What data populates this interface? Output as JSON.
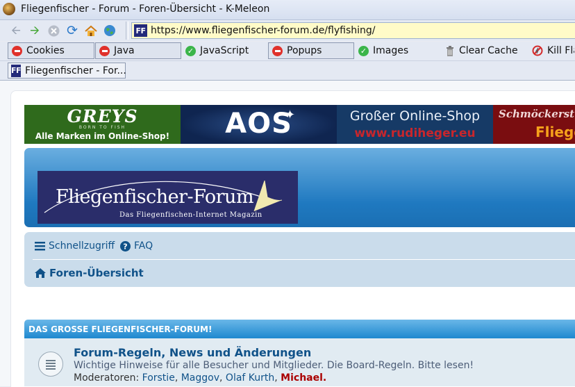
{
  "window": {
    "title": "Fliegenfischer - Forum - Foren-Übersicht - K-Meleon"
  },
  "navbar": {
    "url": "https://www.fliegenfischer-forum.de/flyfishing/",
    "site_icon": "FF",
    "buttons": [
      "back-icon",
      "forward-icon",
      "stop-icon",
      "reload-icon",
      "home-icon",
      "globe-icon"
    ]
  },
  "toggles": [
    {
      "label": "Cookies",
      "state": "off"
    },
    {
      "label": "Java",
      "state": "off"
    },
    {
      "label": "JavaScript",
      "state": "on"
    },
    {
      "label": "Popups",
      "state": "off"
    },
    {
      "label": "Images",
      "state": "on"
    },
    {
      "label": "Clear Cache",
      "icon": "trash-icon"
    },
    {
      "label": "Kill Fla",
      "icon": "no-flash-icon"
    }
  ],
  "tab": {
    "label": "Fliegenfischer - For...",
    "icon": "FF"
  },
  "banners": {
    "greys": {
      "brand": "GREYS",
      "tagline": "BORN TO FISH",
      "text": "Alle Marken im Online-Shop!"
    },
    "aos": {
      "brand": "AOS"
    },
    "rudiheger": {
      "line1": "Großer Online-Shop",
      "line2": "www.rudiheger.eu"
    },
    "schmoeckerstube": {
      "line1": "Schmöckerst",
      "line2": "Fliege"
    }
  },
  "logo": {
    "title": "Fliegenfischer-Forum",
    "subtitle": "Das Fliegenfischen-Internet Magazin"
  },
  "forum_nav": {
    "quick_link": "Schnellzugriff",
    "faq": "FAQ",
    "breadcrumb": "Foren-Übersicht"
  },
  "category": {
    "title": "DAS GROSSE FLIEGENFISCHER-FORUM!",
    "forums": [
      {
        "title": "Forum-Regeln, News und Änderungen",
        "description": "Wichtige Hinweise für alle Besucher und Mitglieder. Die Board-Regeln. Bitte lesen!",
        "moderators_label": "Moderatoren:",
        "moderators": [
          "Forstie",
          "Maggov",
          "Olaf Kurth",
          "Michael."
        ]
      }
    ]
  },
  "colors": {
    "link": "#105289",
    "header_blue": "#1f79c0",
    "admin_red": "#aa0000",
    "url_bg": "#fffbc8"
  }
}
